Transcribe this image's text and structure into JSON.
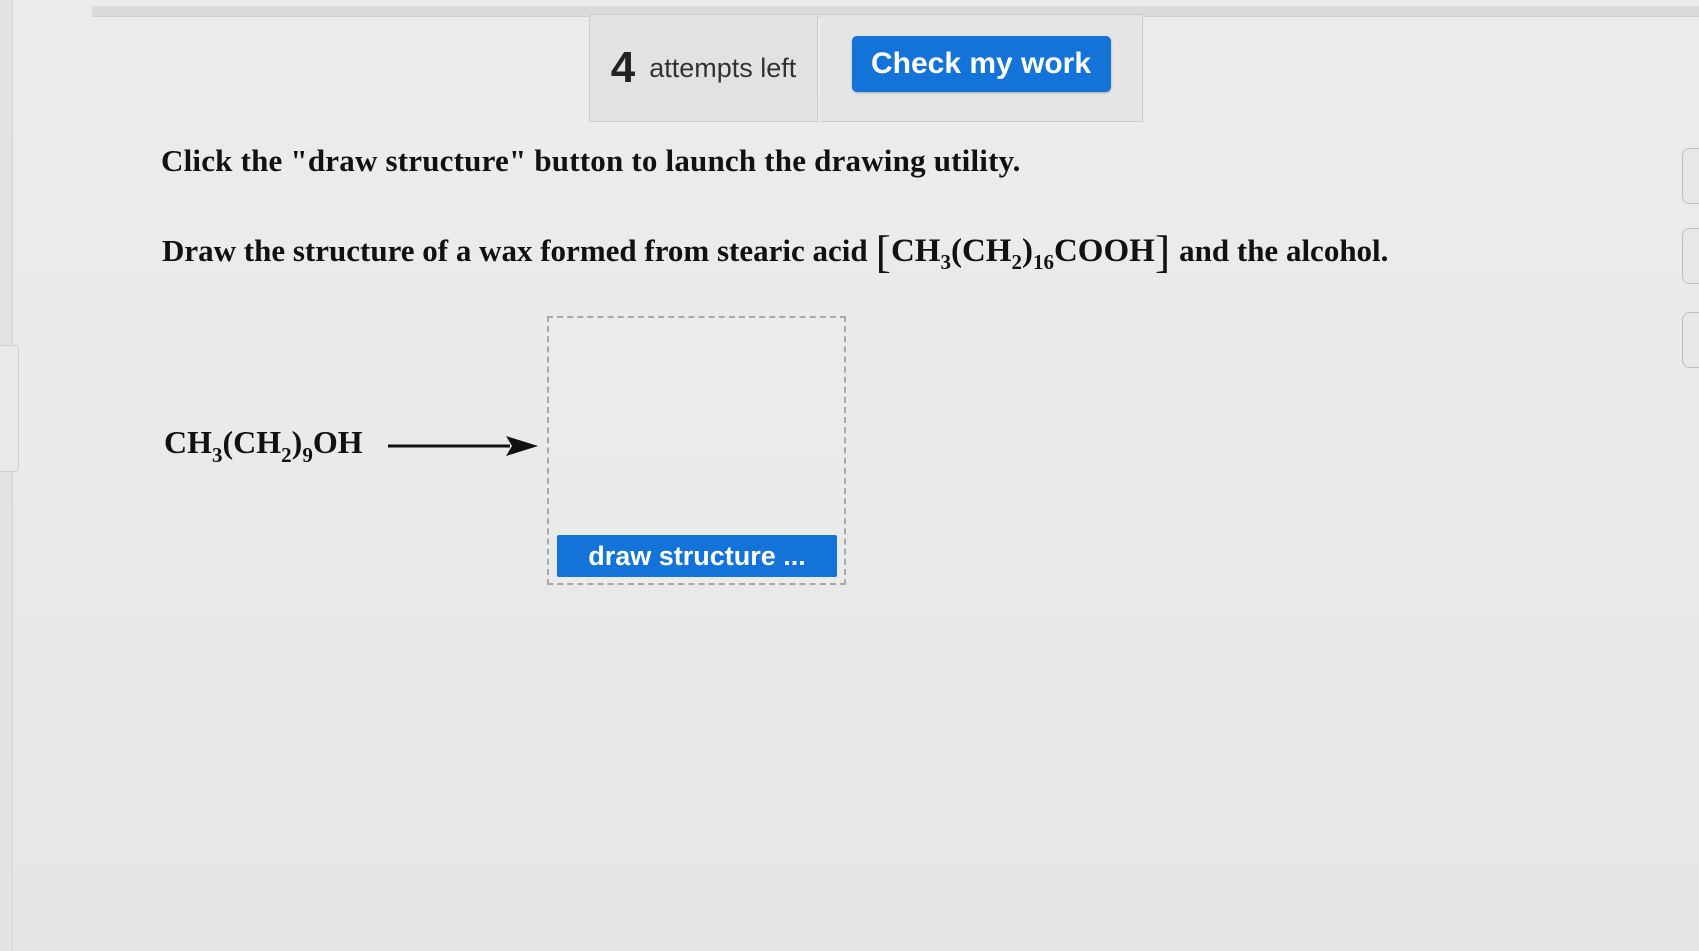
{
  "toolbar": {
    "attempts_count": "4",
    "attempts_label": "attempts left",
    "check_label": "Check my work"
  },
  "content": {
    "instruction": "Click the \"draw structure\" button to launch the drawing utility.",
    "question_prefix": "Draw the structure of a wax formed from stearic acid",
    "question_suffix": "and the alcohol.",
    "stearic_acid": {
      "p1": "CH",
      "s1": "3",
      "p2": "(CH",
      "s2": "2",
      "p3": ")",
      "s3": "16",
      "p4": "COOH"
    },
    "alcohol": {
      "p1": "CH",
      "s1": "3",
      "p2": "(CH",
      "s2": "2",
      "p3": ")",
      "s3": "9",
      "p4": "OH"
    },
    "draw_button_label": "draw structure ..."
  },
  "colors": {
    "primary_button": "#1473d8",
    "background": "#ebebeb"
  },
  "icons": {
    "reaction_arrow": "right-arrow-icon"
  }
}
